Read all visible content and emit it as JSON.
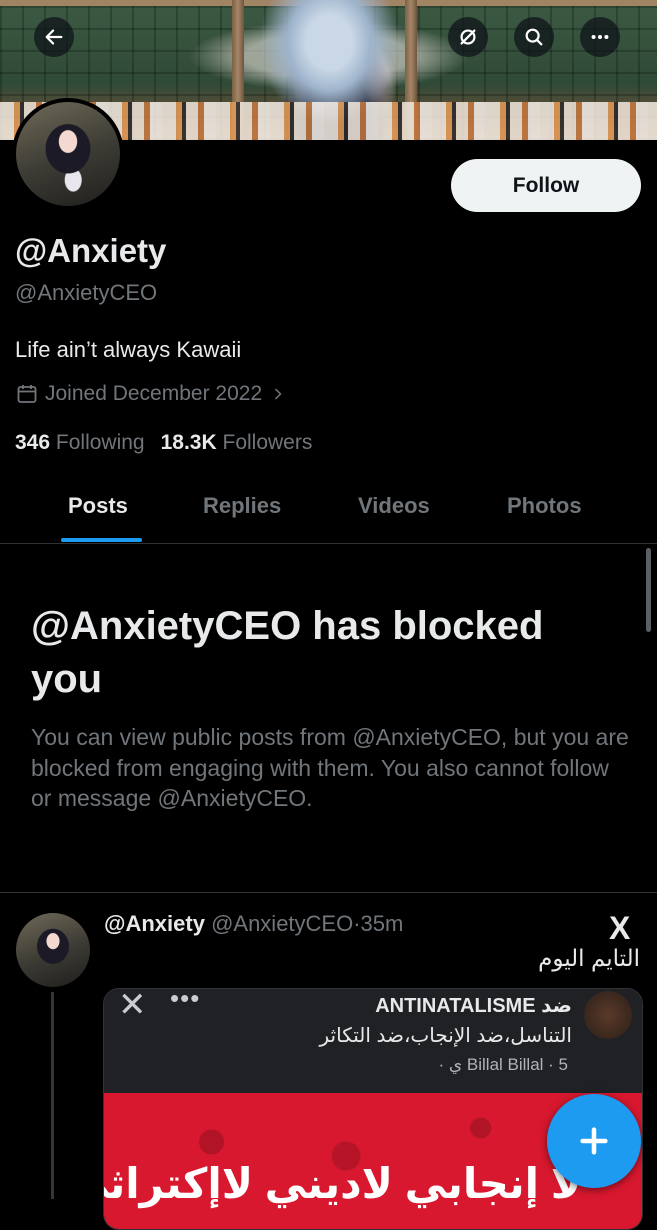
{
  "header": {
    "back_icon": "arrow-left-icon",
    "grok_icon": "grok-icon",
    "search_icon": "search-icon",
    "more_icon": "more-icon"
  },
  "profile": {
    "name": "@Anxiety",
    "handle": "@AnxietyCEO",
    "bio": "Life ain’t always Kawaii",
    "joined": "Joined December 2022",
    "following_count": "346",
    "following_label": "Following",
    "followers_count": "18.3K",
    "followers_label": "Followers",
    "follow_button": "Follow"
  },
  "tabs": [
    {
      "label": "Posts",
      "active": true
    },
    {
      "label": "Replies",
      "active": false
    },
    {
      "label": "Videos",
      "active": false
    },
    {
      "label": "Photos",
      "active": false
    }
  ],
  "blocked": {
    "title": "@AnxietyCEO has blocked you",
    "description": "You can view public posts from @AnxietyCEO, but you are blocked from engaging with them. You also cannot follow or message @AnxietyCEO."
  },
  "post": {
    "name": "@Anxiety",
    "handle": "@AnxietyCEO",
    "separator": "·",
    "time": "35m",
    "source_logo": "X",
    "text": "التايم اليوم",
    "media": {
      "close": "✕",
      "dots": "•••",
      "group_title": "ضد ANTINATALISME",
      "group_subtitle": "التناسل،ضد الإنجاب،ضد التكاثر",
      "meta": "Billal Billal · 5 ي ·",
      "overlay_text": "لا إنجابي لاديني لاإكتراثي"
    }
  },
  "compose_icon": "plus-icon",
  "colors": {
    "accent": "#1d9bf0",
    "background": "#000000",
    "secondary_text": "#71767b"
  }
}
